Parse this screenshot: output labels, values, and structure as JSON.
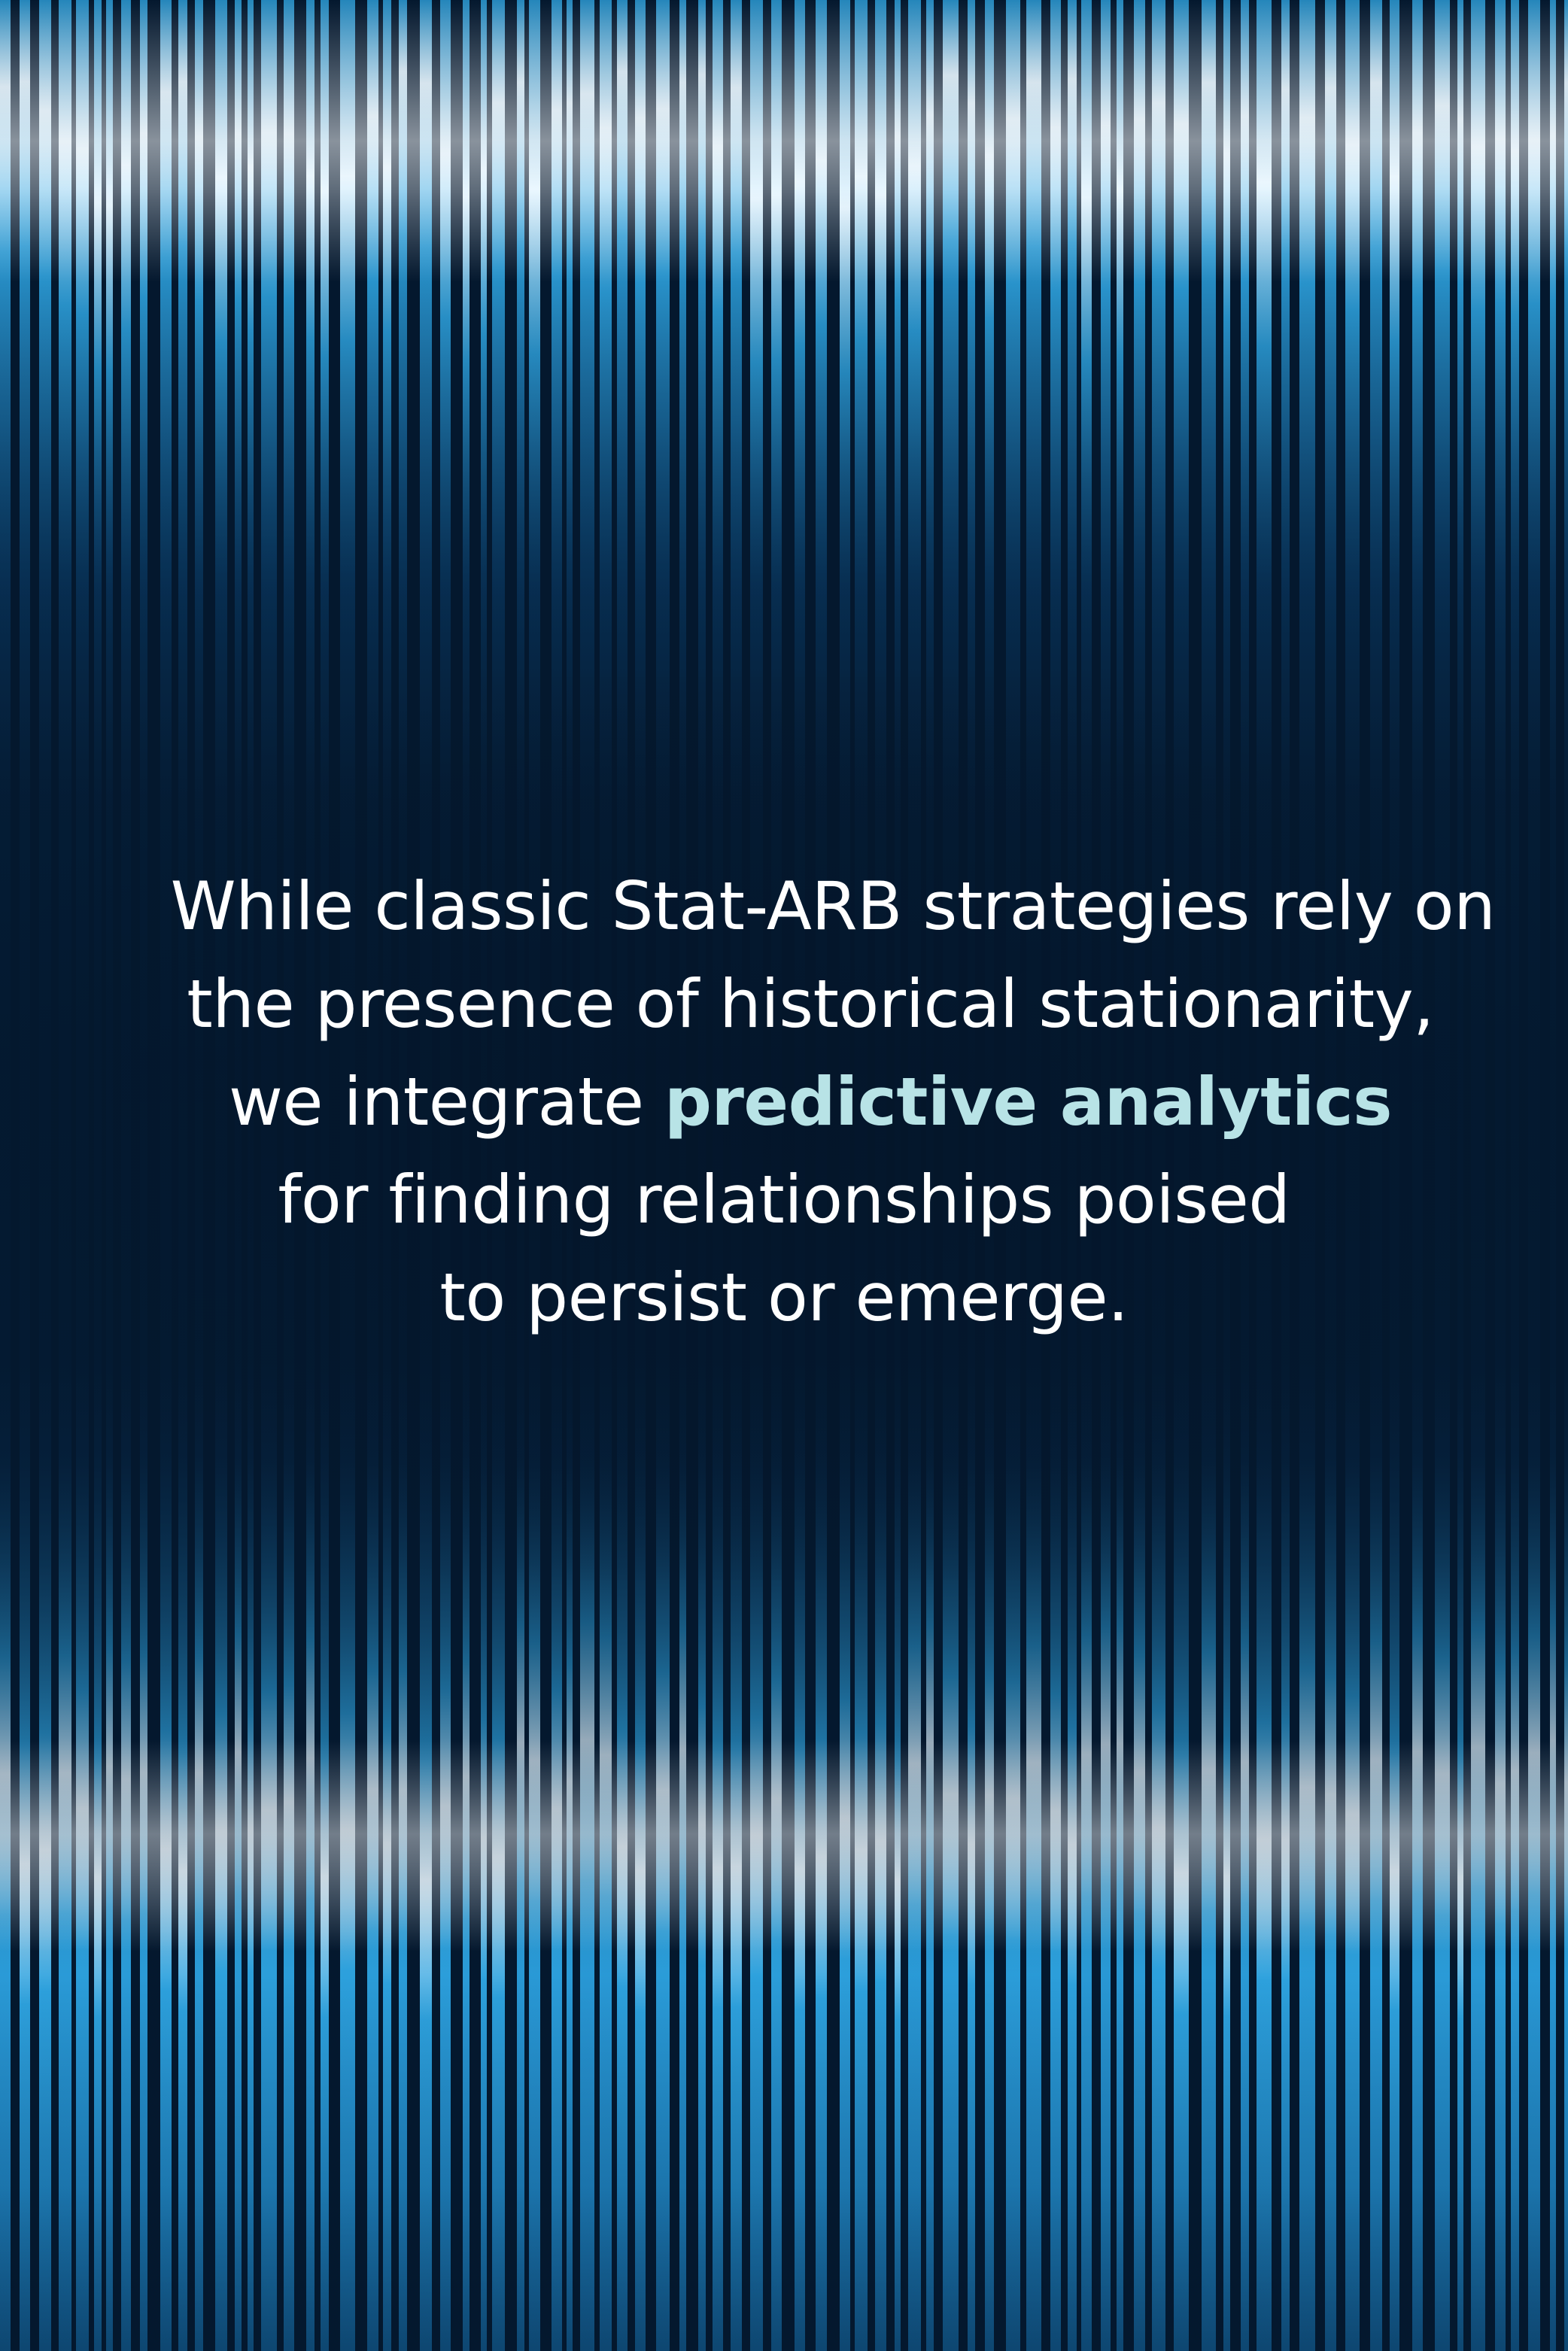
{
  "quote": {
    "line1": "While classic Stat-ARB strategies rely on",
    "line2": "the presence of historical stationarity,",
    "line3_prefix": "we integrate ",
    "line3_highlight": "predictive analytics",
    "line4": "for finding relationships poised",
    "line5": "to persist or emerge."
  },
  "colors": {
    "background": "#04182e",
    "stripe_bright": "#dff3ff",
    "stripe_mid": "#2fa8e6",
    "text": "#ffffff",
    "highlight": "#b8e3e6"
  }
}
